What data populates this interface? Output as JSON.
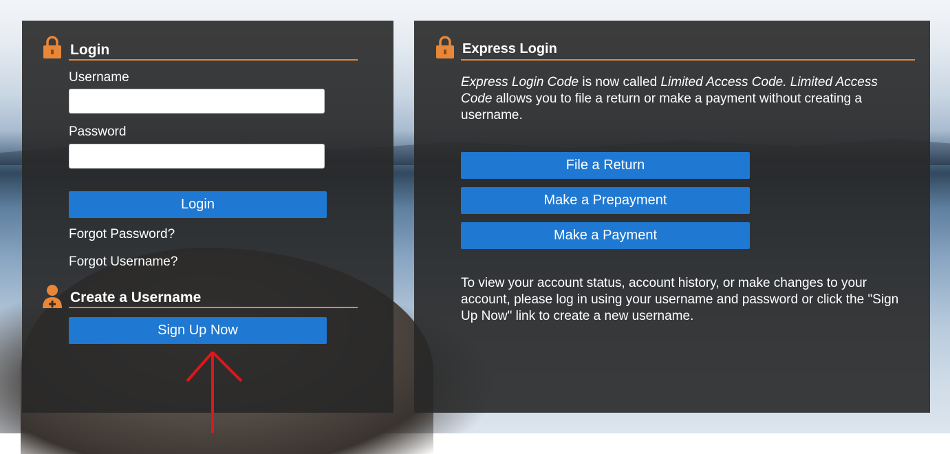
{
  "login": {
    "title": "Login",
    "username_label": "Username",
    "username_value": "",
    "password_label": "Password",
    "password_value": "",
    "login_button": "Login",
    "forgot_password": "Forgot Password?",
    "forgot_username": "Forgot Username?"
  },
  "create": {
    "title": "Create a Username",
    "signup_button": "Sign Up Now"
  },
  "express": {
    "title": "Express Login",
    "intro": {
      "part1": "Express Login Code",
      "part2": " is now called ",
      "part3": "Limited Access Code. Limited Access Code",
      "part4": " allows you to file a return or make a payment without creating a username."
    },
    "buttons": {
      "file_return": "File a Return",
      "prepayment": "Make a Prepayment",
      "payment": "Make a Payment"
    },
    "footer": "To view your account status, account history, or make changes to your account, please log in using your username and password or click the \"Sign Up Now\" link to create a new username."
  },
  "colors": {
    "accent": "#e8873a",
    "button": "#1f78d1",
    "panel": "#282828",
    "annotation_arrow": "#e0161b"
  },
  "icons": {
    "lock": "lock-icon",
    "add_user": "add-user-icon",
    "arrow": "red-arrow-annotation"
  }
}
